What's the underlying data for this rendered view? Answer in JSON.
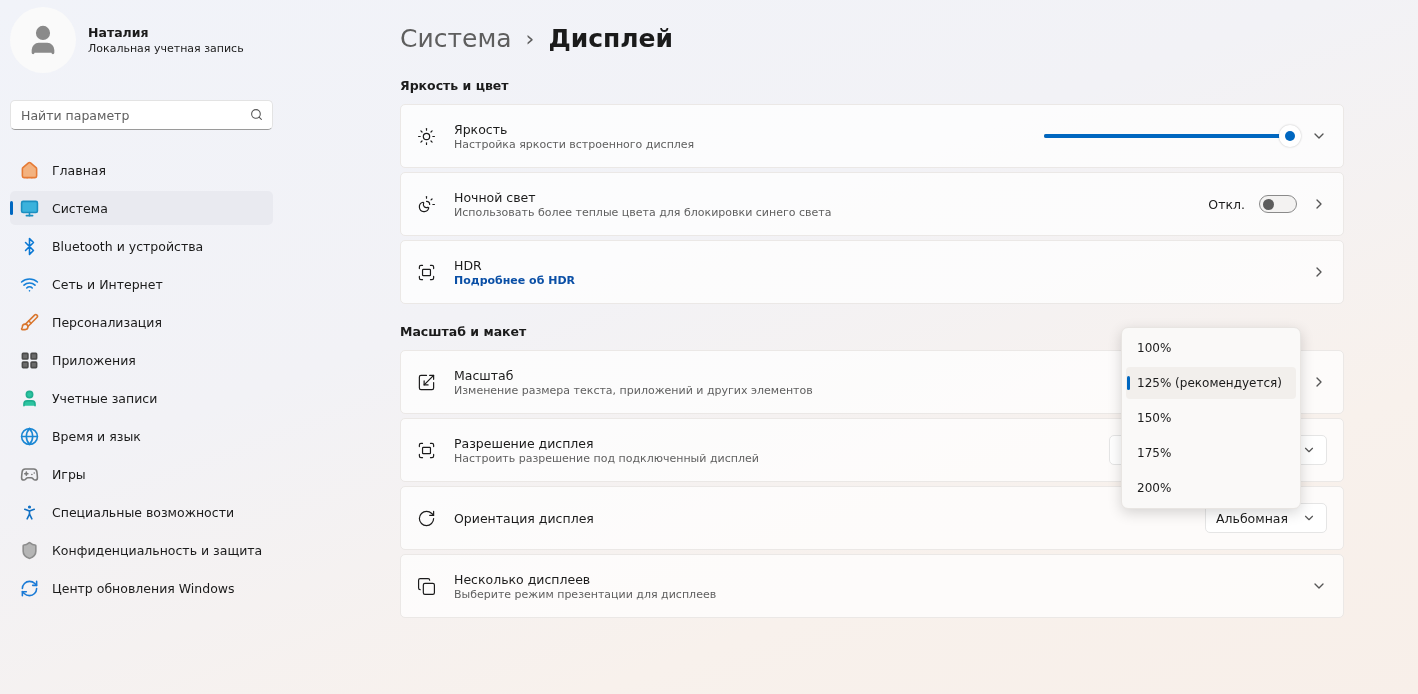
{
  "profile": {
    "name": "Наталия",
    "account": "Локальная учетная запись"
  },
  "search": {
    "placeholder": "Найти параметр"
  },
  "nav": [
    {
      "label": "Главная",
      "selected": false
    },
    {
      "label": "Система",
      "selected": true
    },
    {
      "label": "Bluetooth и устройства",
      "selected": false
    },
    {
      "label": "Сеть и Интернет",
      "selected": false
    },
    {
      "label": "Персонализация",
      "selected": false
    },
    {
      "label": "Приложения",
      "selected": false
    },
    {
      "label": "Учетные записи",
      "selected": false
    },
    {
      "label": "Время и язык",
      "selected": false
    },
    {
      "label": "Игры",
      "selected": false
    },
    {
      "label": "Специальные возможности",
      "selected": false
    },
    {
      "label": "Конфиденциальность и защита",
      "selected": false
    },
    {
      "label": "Центр обновления Windows",
      "selected": false
    }
  ],
  "breadcrumb": {
    "parent": "Система",
    "separator": "›",
    "current": "Дисплей"
  },
  "sections": [
    {
      "title": "Яркость и цвет",
      "rows": [
        {
          "kind": "slider",
          "title": "Яркость",
          "subtitle": "Настройка яркости встроенного дисплея",
          "level": 1
        },
        {
          "kind": "toggle",
          "title": "Ночной свет",
          "subtitle": "Использовать более теплые цвета для блокировки синего света",
          "state": "Откл.",
          "on": false
        },
        {
          "kind": "link",
          "title": "HDR",
          "link": "Подробнее об HDR"
        }
      ]
    },
    {
      "title": "Масштаб и макет",
      "rows": [
        {
          "kind": "chevron",
          "title": "Масштаб",
          "subtitle": "Изменение размера текста, приложений и других элементов"
        },
        {
          "kind": "dropdown",
          "title": "Разрешение дисплея",
          "subtitle": "Настроить разрешение под подключенный дисплей"
        },
        {
          "kind": "dropdown",
          "title": "Ориентация дисплея",
          "value": "Альбомная"
        },
        {
          "kind": "expand",
          "title": "Несколько дисплеев",
          "subtitle": "Выберите режим презентации для дисплеев"
        }
      ]
    }
  ],
  "scale_menu": [
    {
      "label": "100%",
      "selected": false
    },
    {
      "label": "125% (рекомендуется)",
      "selected": true
    },
    {
      "label": "150%",
      "selected": false
    },
    {
      "label": "175%",
      "selected": false
    },
    {
      "label": "200%",
      "selected": false
    }
  ]
}
